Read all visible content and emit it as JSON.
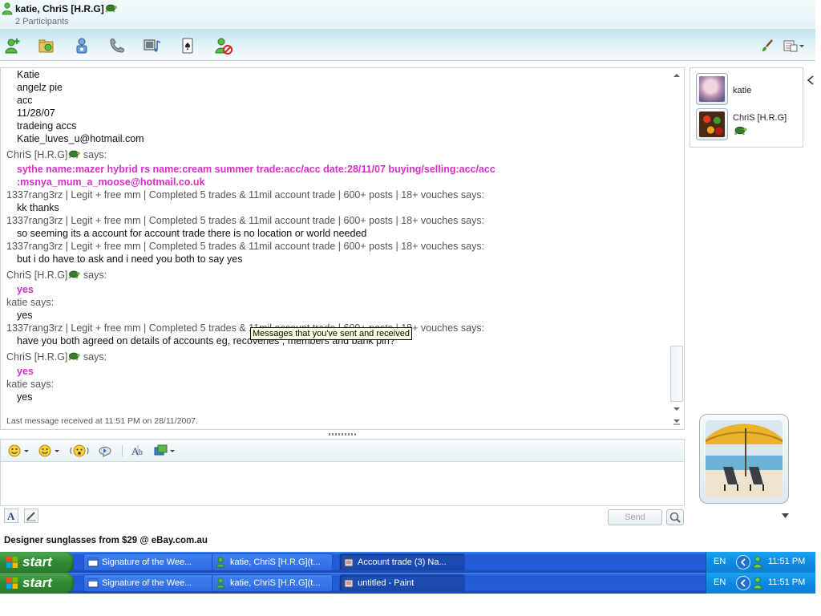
{
  "window": {
    "title": "katie, ChriS [H.R.G]",
    "subtitle": "2 Participants"
  },
  "toolbar": {
    "buttons": [
      {
        "name": "invite-icon"
      },
      {
        "name": "send-files-icon"
      },
      {
        "name": "video-call-icon"
      },
      {
        "name": "call-icon"
      },
      {
        "name": "activities-icon"
      },
      {
        "name": "games-icon"
      },
      {
        "name": "block-icon"
      }
    ]
  },
  "conversation": {
    "lines": [
      {
        "kind": "text",
        "text": "Katie"
      },
      {
        "kind": "text",
        "text": "angelz pie"
      },
      {
        "kind": "text",
        "text": "acc"
      },
      {
        "kind": "text",
        "text": "11/28/07"
      },
      {
        "kind": "text",
        "text": "tradeing accs"
      },
      {
        "kind": "text",
        "text": "Katie_luves_u@hotmail.com"
      },
      {
        "kind": "sender",
        "name": "ChriS [H.R.G]",
        "turtle": true,
        "says": "says:"
      },
      {
        "kind": "pink",
        "text": "sythe name:mazer hybrid       rs name:cream summer      trade:acc/acc            date:28/11/07                   buying/selling:acc/acc"
      },
      {
        "kind": "pink",
        "text": ":msnya_mum_a_moose@hotmail.co.uk"
      },
      {
        "kind": "sender",
        "name": "1337rang3rz | Legit + free mm | Completed 5 trades & 11mil account trade | 600+ posts | 18+ vouches",
        "turtle": false,
        "says": "says:"
      },
      {
        "kind": "text",
        "text": "kk thanks"
      },
      {
        "kind": "sender",
        "name": "1337rang3rz | Legit + free mm | Completed 5 trades & 11mil account trade | 600+ posts | 18+ vouches",
        "turtle": false,
        "says": "says:"
      },
      {
        "kind": "text",
        "text": "so seeming its a account for account trade there is no location or world needed"
      },
      {
        "kind": "sender",
        "name": "1337rang3rz | Legit + free mm | Completed 5 trades & 11mil account trade | 600+ posts | 18+ vouches",
        "turtle": false,
        "says": "says:"
      },
      {
        "kind": "text",
        "text": "but i do have to ask and i need you both to say yes"
      },
      {
        "kind": "sender",
        "name": "ChriS [H.R.G]",
        "turtle": true,
        "says": "says:"
      },
      {
        "kind": "pink",
        "text": "yes"
      },
      {
        "kind": "sender",
        "name": "katie",
        "turtle": false,
        "says": "says:"
      },
      {
        "kind": "text",
        "text": "yes"
      },
      {
        "kind": "sender",
        "name": "1337rang3rz | Legit + free mm | Completed 5 trades & 11mil account trade | 600+ posts | 18+ vouches",
        "turtle": false,
        "says": "says:"
      },
      {
        "kind": "text",
        "text": "have you both agreed on details of accounts eg, recoveries , members and bank pin?"
      },
      {
        "kind": "sender",
        "name": "ChriS [H.R.G]",
        "turtle": true,
        "says": "says:"
      },
      {
        "kind": "pink",
        "text": "yes"
      },
      {
        "kind": "sender",
        "name": "katie",
        "turtle": false,
        "says": "says:"
      },
      {
        "kind": "text",
        "text": "yes"
      }
    ],
    "status": "Last message received at 11:51 PM on 28/11/2007.",
    "tooltip": "Messages that you've sent and received"
  },
  "participants": [
    {
      "name": "katie"
    },
    {
      "name": "ChriS [H.R.G]"
    }
  ],
  "input": {
    "send_label": "Send"
  },
  "ad": {
    "text": "Designer sunglasses from $29 @ eBay.com.au"
  },
  "taskbars": [
    {
      "start": "start",
      "tasks": [
        {
          "label": "Signature of the Wee...",
          "active": false
        },
        {
          "label": "katie, ChriS [H.R.G](t...",
          "active": false
        },
        {
          "label": "Account trade (3) Na...",
          "active": true
        }
      ],
      "lang": "EN",
      "clock": "11:51 PM"
    },
    {
      "start": "start",
      "tasks": [
        {
          "label": "Signature of the Wee...",
          "active": false
        },
        {
          "label": "katie, ChriS [H.R.G](t...",
          "active": false
        },
        {
          "label": "untitled - Paint",
          "active": true
        }
      ],
      "lang": "EN",
      "clock": "11:51 PM"
    }
  ],
  "colors": {
    "pink_message": "#d630c6",
    "taskbar_blue": "#245ddb",
    "start_green": "#2f8a32"
  }
}
